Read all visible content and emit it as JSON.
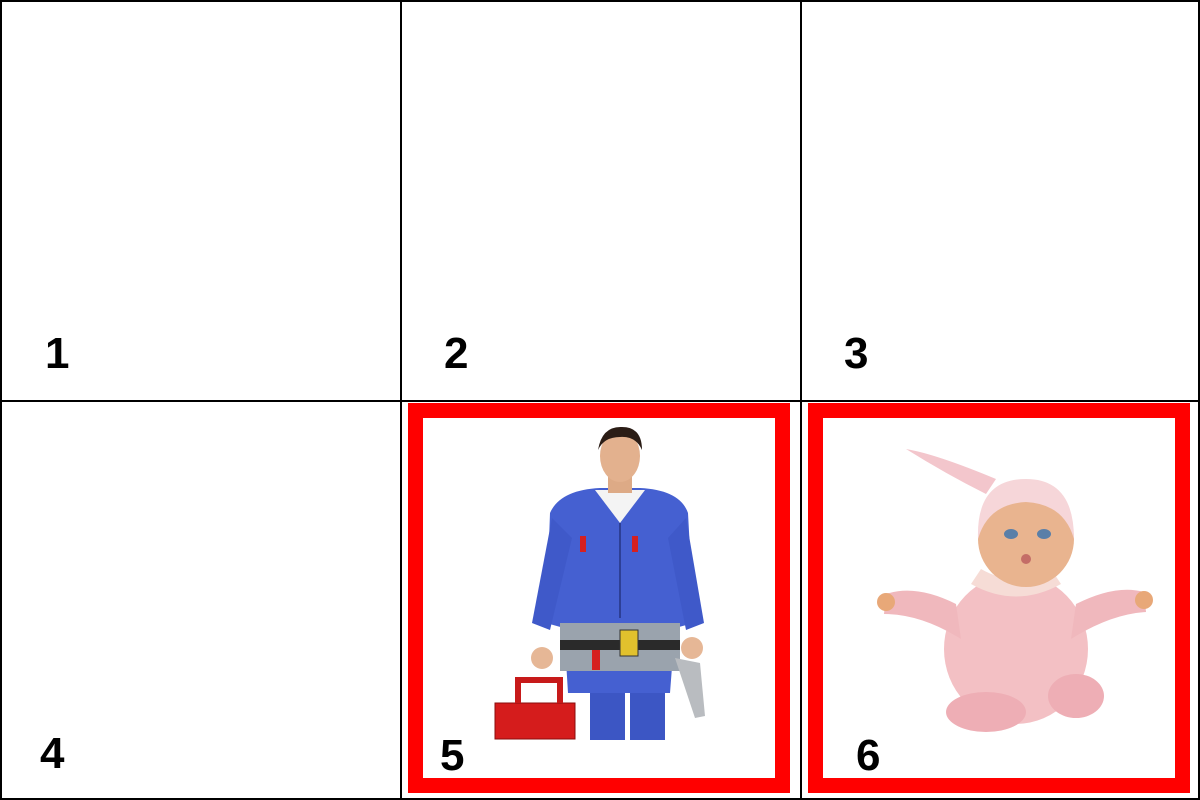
{
  "cells": [
    {
      "number": "1",
      "selected": false
    },
    {
      "number": "2",
      "selected": false
    },
    {
      "number": "3",
      "selected": false
    },
    {
      "number": "4",
      "selected": false
    },
    {
      "number": "5",
      "selected": true,
      "image": "worker-photo"
    },
    {
      "number": "6",
      "selected": true,
      "image": "baby-doll-photo"
    }
  ],
  "colors": {
    "grid_line": "#000000",
    "selection_border": "#ff0000",
    "background": "#ffffff"
  }
}
